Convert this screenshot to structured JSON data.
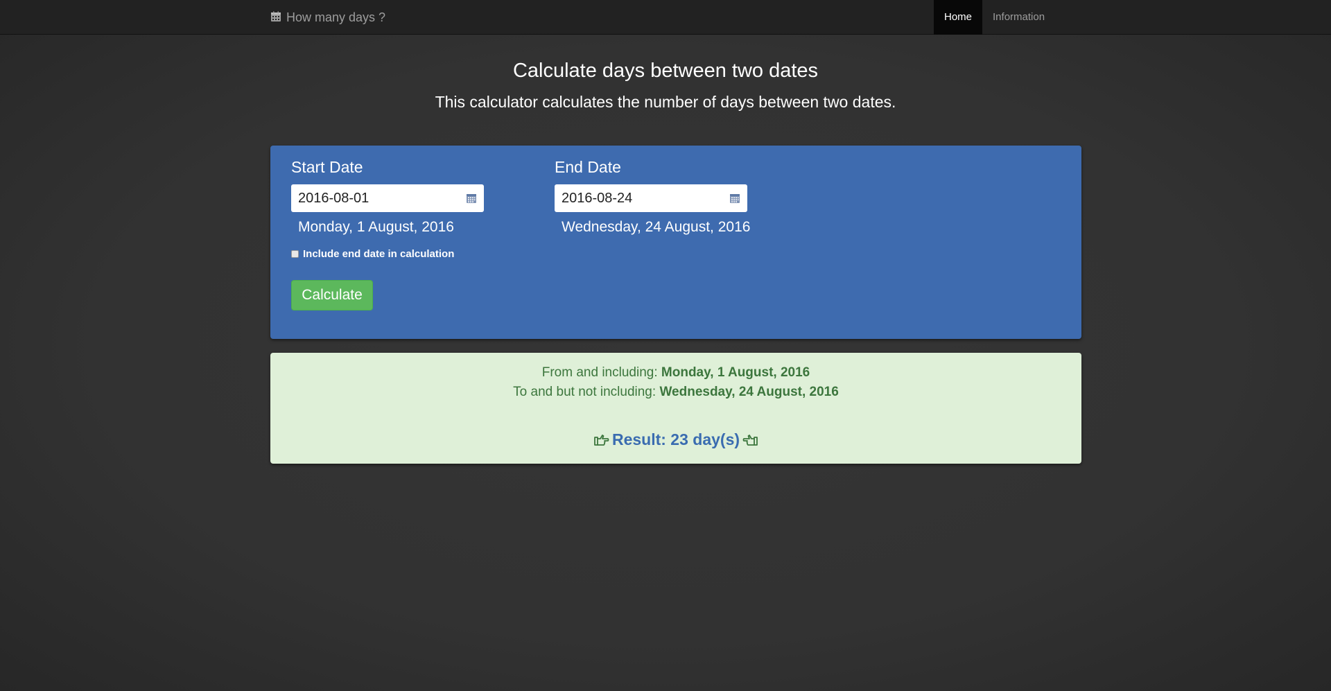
{
  "navbar": {
    "brand": "How many days ?",
    "brand_icon": "calendar-icon",
    "items": [
      {
        "label": "Home",
        "active": true
      },
      {
        "label": "Information",
        "active": false
      }
    ]
  },
  "header": {
    "title": "Calculate days between two dates",
    "subtitle": "This calculator calculates the number of days between two dates."
  },
  "form": {
    "start": {
      "label": "Start Date",
      "value": "2016-08-01",
      "readable": "Monday, 1 August, 2016",
      "icon": "calendar-icon"
    },
    "end": {
      "label": "End Date",
      "value": "2016-08-24",
      "readable": "Wednesday, 24 August, 2016",
      "icon": "calendar-icon"
    },
    "include_end": {
      "label": "Include end date in calculation",
      "checked": false
    },
    "calculate_label": "Calculate"
  },
  "result": {
    "from_prefix": "From and including:",
    "from_value": "Monday, 1 August, 2016",
    "to_prefix": "To and but not including:",
    "to_value": "Wednesday, 24 August, 2016",
    "summary": "Result: 23 day(s)",
    "left_icon": "hand-pointing-right-icon",
    "right_icon": "hand-pointing-left-icon"
  },
  "colors": {
    "navbar_bg": "#222222",
    "panel_blue": "#3e6baf",
    "result_bg": "#dff0d8",
    "result_text": "#3c763d",
    "result_accent": "#3a6cb0",
    "button_green": "#5cb85c"
  }
}
